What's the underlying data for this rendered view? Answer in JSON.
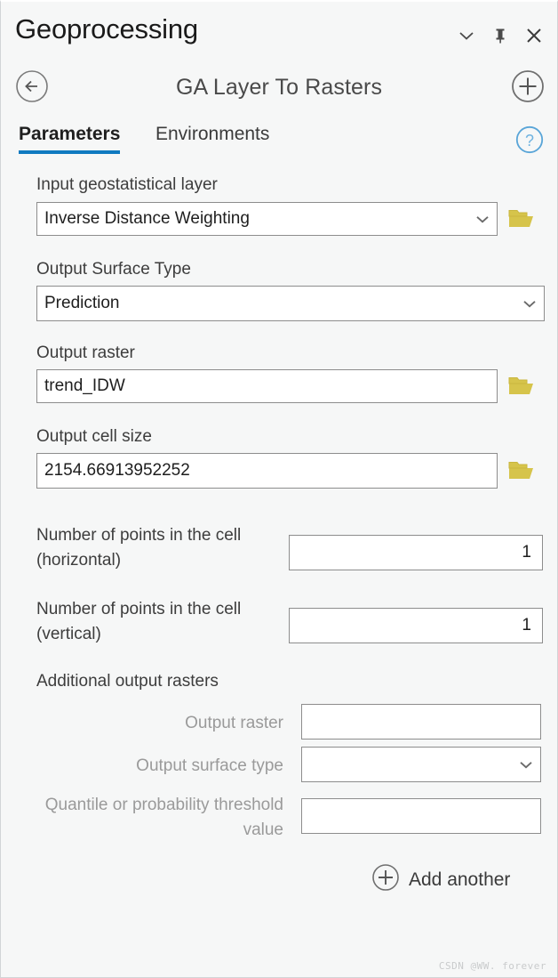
{
  "window": {
    "title": "Geoprocessing",
    "controls": [
      {
        "name": "collapse-icon",
        "label": "⌄"
      },
      {
        "name": "pin-icon",
        "label": "pin"
      },
      {
        "name": "close-icon",
        "label": "✕"
      }
    ]
  },
  "tool": {
    "title": "GA Layer To Rasters",
    "back_icon": "back-arrow-icon",
    "add_icon": "plus-circle-icon"
  },
  "tabs": [
    {
      "label": "Parameters",
      "active": true
    },
    {
      "label": "Environments",
      "active": false
    }
  ],
  "help": {
    "icon": "help-circle-icon",
    "glyph": "?"
  },
  "parameters": {
    "input_layer": {
      "label": "Input geostatistical layer",
      "value": "Inverse Distance Weighting",
      "placeholder": "",
      "has_browse": true
    },
    "output_surface_type": {
      "label": "Output Surface Type",
      "value": "Prediction",
      "placeholder": "",
      "has_browse": false
    },
    "output_raster": {
      "label": "Output raster",
      "value": "trend_IDW",
      "placeholder": "",
      "has_browse": true
    },
    "output_cell_size": {
      "label": "Output cell size",
      "value": "2154.66913952252",
      "placeholder": "",
      "has_browse": true
    },
    "points_horizontal": {
      "label": "Number of points in the cell (horizontal)",
      "value": "1"
    },
    "points_vertical": {
      "label": "Number of points in the cell (vertical)",
      "value": "1"
    }
  },
  "additional_rasters": {
    "section_label": "Additional output rasters",
    "output_raster": {
      "label": "Output raster",
      "value": ""
    },
    "output_surface_type": {
      "label": "Output surface type",
      "value": ""
    },
    "quantile": {
      "label": "Quantile or probability threshold value",
      "value": ""
    },
    "add_another_label": "Add another",
    "add_another_icon": "plus-circle-icon"
  },
  "watermark": "CSDN @WW. forever",
  "colors": {
    "accent": "#0f7ac0",
    "panel_bg": "#f6f7f7",
    "field_border": "#8d8d8d",
    "folder": "#d6c44b",
    "help": "#59a5d8",
    "muted_text": "#9a9a9a"
  }
}
